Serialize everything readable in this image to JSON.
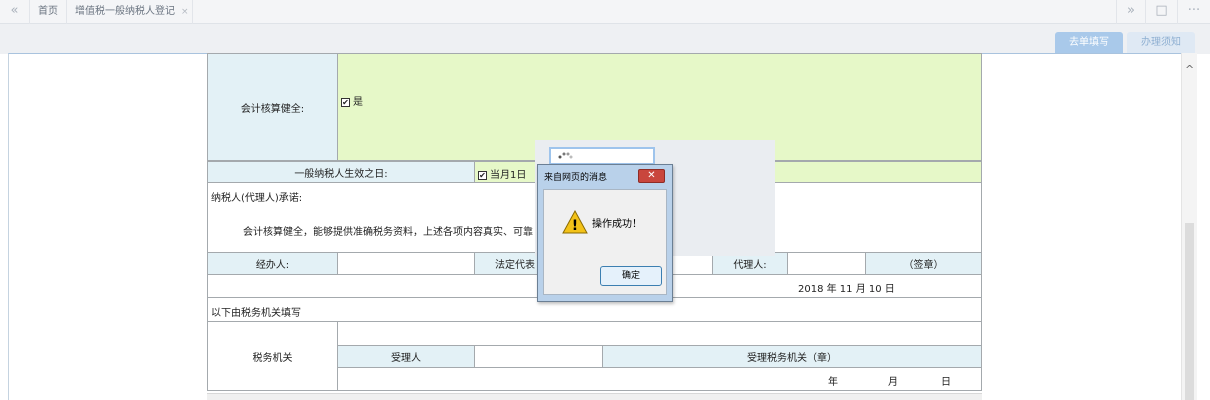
{
  "tabbar": {
    "back_icon": "«",
    "home_label": "首页",
    "active_tab_label": "增值税一般纳税人登记",
    "close_icon": "×",
    "forward_icon": "»",
    "window_icon": "□",
    "more_icon": "···"
  },
  "side_tabs": {
    "fill_form": "去单填写",
    "guide": "办理须知"
  },
  "form": {
    "accounting_label": "会计核算健全:",
    "accounting_checked": "✔",
    "accounting_value": "是",
    "effective_date_label": "一般纳税人生效之日:",
    "effective_checked": "✔",
    "effective_value": "当月1日",
    "promise_label": "纳税人(代理人)承诺:",
    "promise_text": "会计核算健全，能够提供准确税务资料，上述各项内容真实、可靠",
    "handler_label": "经办人:",
    "legal_rep_label": "法定代表",
    "agent_label": "代理人:",
    "seal_label": "（签章）",
    "sign_date": "2018 年 11 月 10 日",
    "tax_office_section": "以下由税务机关填写",
    "tax_office_label": "税务机关",
    "receiver_label": "受理人",
    "receiving_office_label": "受理税务机关（章）",
    "year_label": "年",
    "month_label": "月",
    "day_label": "日"
  },
  "dialog": {
    "title": "来自网页的消息",
    "close_icon": "✕",
    "warning_icon": "!",
    "message": "操作成功！",
    "ok_label": "确定"
  },
  "scrollbar": {
    "up_icon": "^"
  }
}
